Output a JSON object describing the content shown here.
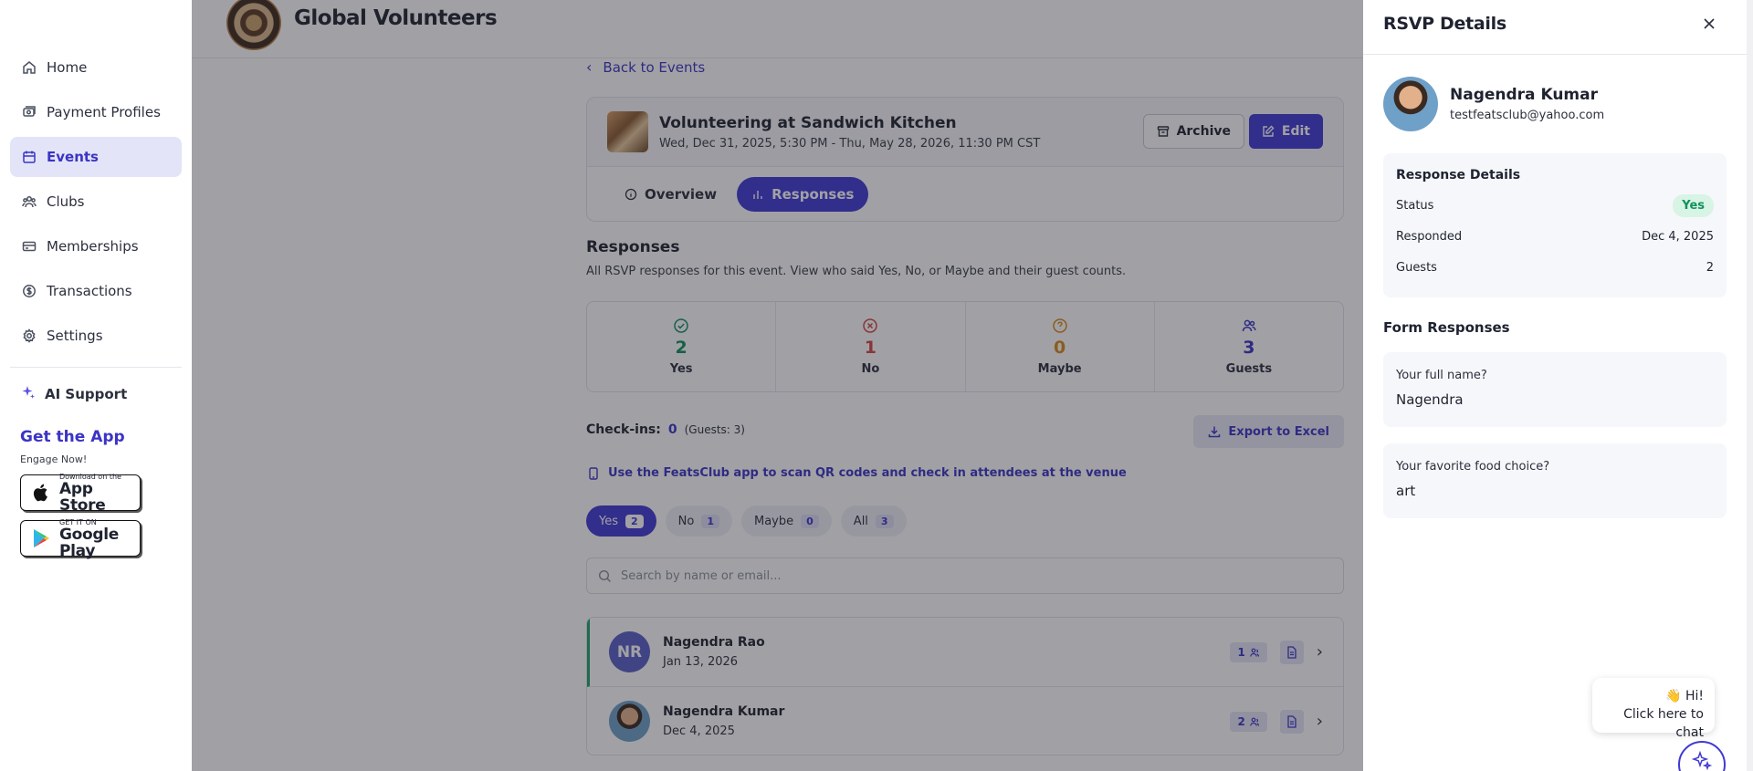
{
  "sidebar": {
    "items": [
      {
        "label": "Home",
        "icon": "home-icon",
        "active": false
      },
      {
        "label": "Payment Profiles",
        "icon": "payment-icon",
        "active": false
      },
      {
        "label": "Events",
        "icon": "calendar-icon",
        "active": true
      },
      {
        "label": "Clubs",
        "icon": "users-icon",
        "active": false
      },
      {
        "label": "Memberships",
        "icon": "card-icon",
        "active": false
      },
      {
        "label": "Transactions",
        "icon": "dollar-icon",
        "active": false
      },
      {
        "label": "Settings",
        "icon": "gear-icon",
        "active": false
      }
    ],
    "ai_support": "AI Support",
    "get_app_title": "Get the App",
    "get_app_sub": "Engage Now!",
    "app_store": {
      "small": "Download on the",
      "big": "App Store"
    },
    "google_play": {
      "small": "GET IT ON",
      "big": "Google Play"
    }
  },
  "header": {
    "org_name": "Global Volunteers"
  },
  "main": {
    "back_label": "Back to Events",
    "event": {
      "title": "Volunteering at Sandwich Kitchen",
      "date": "Wed, Dec 31, 2025, 5:30 PM - Thu, May 28, 2026, 11:30 PM CST",
      "archive_label": "Archive",
      "edit_label": "Edit"
    },
    "tabs": [
      {
        "label": "Overview",
        "active": false
      },
      {
        "label": "Responses",
        "active": true
      }
    ],
    "responses_title": "Responses",
    "responses_desc": "All RSVP responses for this event. View who said Yes, No, or Maybe and their guest counts.",
    "stats": [
      {
        "num": "2",
        "label": "Yes",
        "color": "#12915c"
      },
      {
        "num": "1",
        "label": "No",
        "color": "#d64545"
      },
      {
        "num": "0",
        "label": "Maybe",
        "color": "#d98a1a"
      },
      {
        "num": "3",
        "label": "Guests",
        "color": "#3b34c5"
      }
    ],
    "checkins_label": "Check-ins:",
    "checkins_count": "0",
    "checkins_guests": "(Guests: 3)",
    "export_label": "Export to Excel",
    "qr_note": "Use the FeatsClub app to scan QR codes and check in attendees at the venue",
    "filters": [
      {
        "label": "Yes",
        "count": "2",
        "active": true
      },
      {
        "label": "No",
        "count": "1",
        "active": false
      },
      {
        "label": "Maybe",
        "count": "0",
        "active": false
      },
      {
        "label": "All",
        "count": "3",
        "active": false
      }
    ],
    "search_placeholder": "Search by name or email...",
    "rows": [
      {
        "initials": "NR",
        "name": "Nagendra Rao",
        "date": "Jan 13, 2026",
        "guests": "1"
      },
      {
        "initials": "",
        "name": "Nagendra Kumar",
        "date": "Dec 4, 2025",
        "guests": "2"
      }
    ]
  },
  "drawer": {
    "title": "RSVP Details",
    "name": "Nagendra Kumar",
    "email": "testfeatsclub@yahoo.com",
    "response_details_title": "Response Details",
    "status_label": "Status",
    "status_value": "Yes",
    "responded_label": "Responded",
    "responded_value": "Dec 4, 2025",
    "guests_label": "Guests",
    "guests_value": "2",
    "form_title": "Form Responses",
    "questions": [
      {
        "q": "Your full name?",
        "a": "Nagendra"
      },
      {
        "q": "Your favorite food choice?",
        "a": "art"
      }
    ]
  },
  "chat": {
    "line1": "👋 Hi!",
    "line2": "Click here to chat"
  },
  "colors": {
    "brand": "#4039d4",
    "success": "#12915c",
    "danger": "#d64545",
    "warning": "#d98a1a"
  }
}
